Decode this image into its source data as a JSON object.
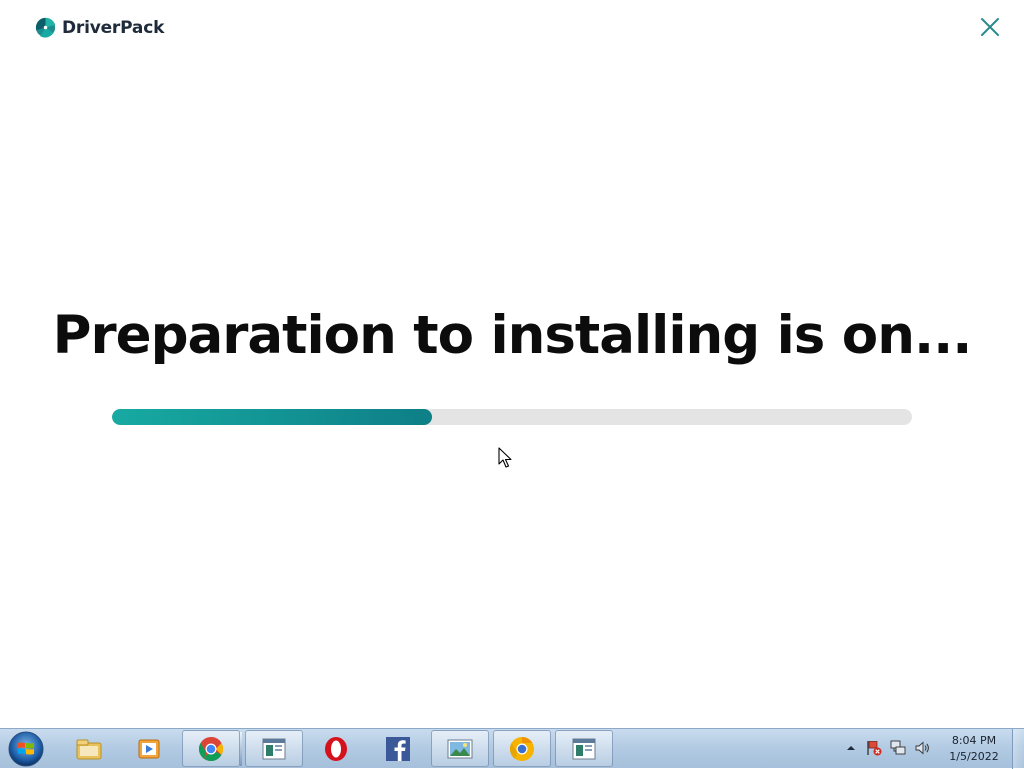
{
  "app": {
    "brand": "DriverPack",
    "headline": "Preparation to installing is on...",
    "progress_percent": 40,
    "colors": {
      "brand_teal": "#17aaa2",
      "brand_teal_dark": "#0e7f87",
      "track": "#e4e4e4",
      "close_icon": "#2a8a8c"
    },
    "icons": {
      "logo": "driverpack-logo-icon",
      "close": "close-icon"
    }
  },
  "taskbar": {
    "start_icon": "windows-start-icon",
    "pinned": [
      {
        "name": "windows-explorer-icon",
        "active": false
      },
      {
        "name": "media-player-icon",
        "active": false
      },
      {
        "name": "chrome-icon",
        "active": true
      }
    ],
    "running": [
      {
        "name": "app-window-icon",
        "active": true
      },
      {
        "name": "opera-icon",
        "active": false
      },
      {
        "name": "facebook-icon",
        "active": false
      },
      {
        "name": "photo-viewer-icon",
        "active": true
      },
      {
        "name": "chrome-canary-icon",
        "active": true
      },
      {
        "name": "app-window-icon",
        "active": true
      }
    ],
    "tray": {
      "icons": [
        "show-hidden-icons-arrow",
        "action-center-flag-icon",
        "network-icon",
        "volume-icon"
      ],
      "time": "8:04 PM",
      "date": "1/5/2022"
    }
  }
}
